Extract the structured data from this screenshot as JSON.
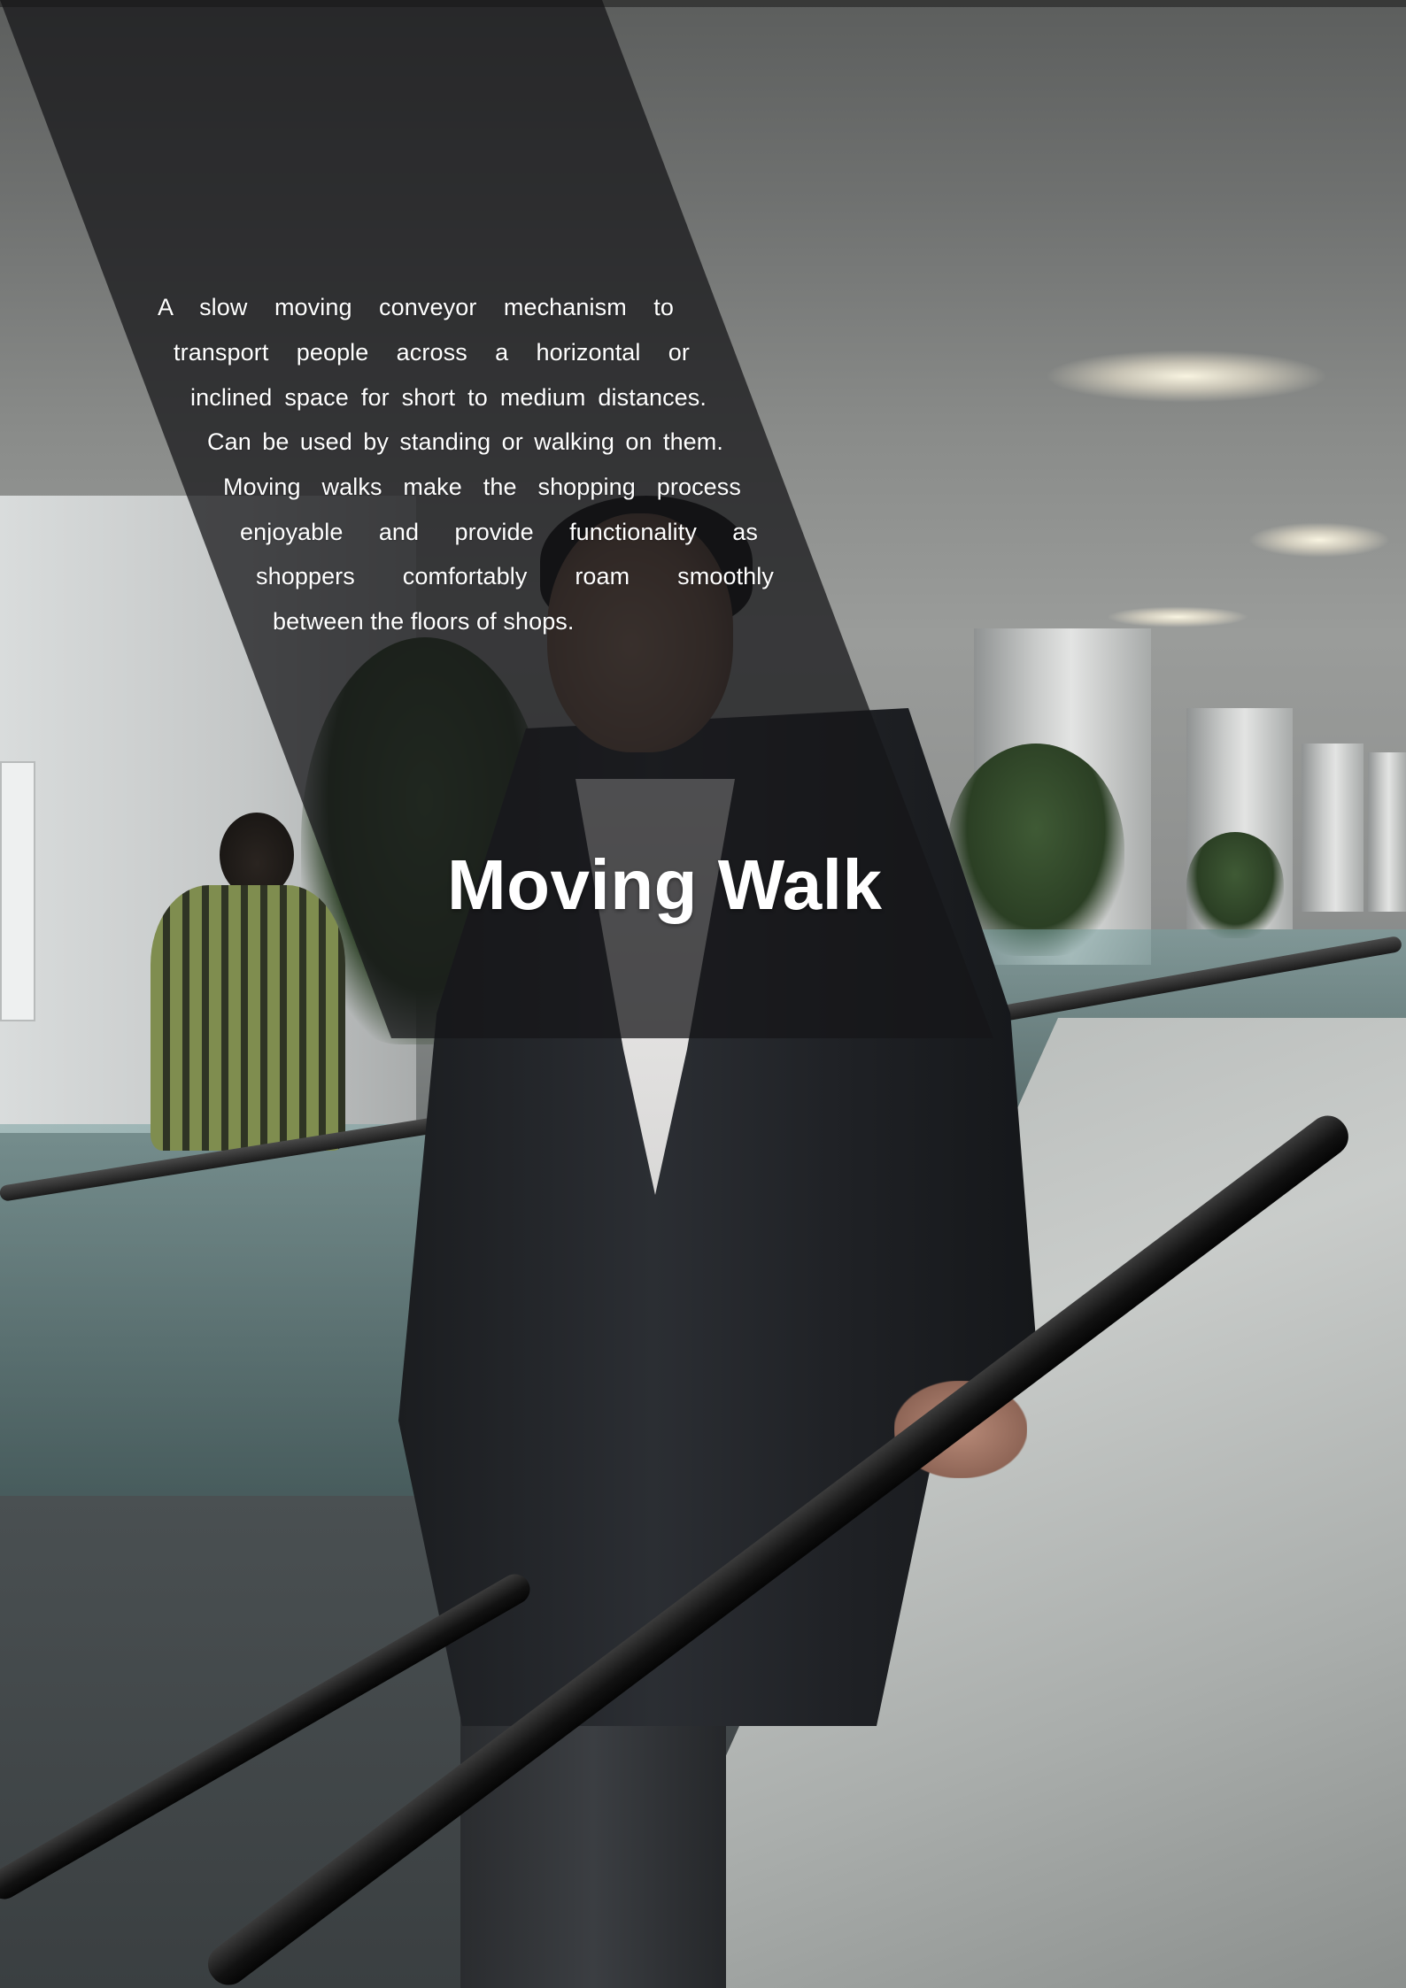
{
  "page": {
    "description_lines": [
      "A   slow   moving   conveyor   mechanism   to",
      "transport   people   across   a   horizontal   or",
      "inclined space for short to medium distances.",
      "Can be used by standing or walking on them.",
      "Moving  walks  make  the  shopping  process",
      "enjoyable   and   provide   functionality    as",
      "shoppers    comfortably    roam    smoothly",
      "between the floors of shops."
    ],
    "title": "Moving Walk"
  },
  "colors": {
    "band_overlay": "#161618",
    "text": "#ffffff"
  }
}
